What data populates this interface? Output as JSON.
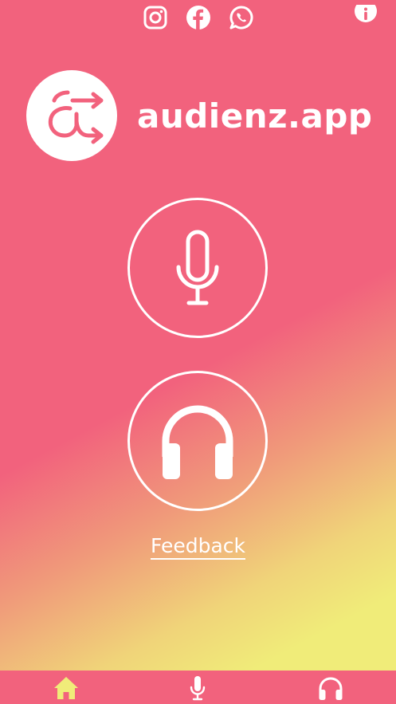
{
  "app": {
    "title": "audienz.app"
  },
  "social": [
    {
      "name": "instagram-icon"
    },
    {
      "name": "facebook-icon"
    },
    {
      "name": "whatsapp-icon"
    }
  ],
  "actions": {
    "speak": {
      "icon": "microphone-icon"
    },
    "listen": {
      "icon": "headphones-icon"
    }
  },
  "feedback": {
    "label": "Feedback"
  },
  "tabs": [
    {
      "icon": "home-icon",
      "active": true
    },
    {
      "icon": "microphone-icon",
      "active": false
    },
    {
      "icon": "headphones-icon",
      "active": false
    }
  ],
  "colors": {
    "primary": "#f2627d",
    "accent_yellow": "#f0ec79",
    "active_tab": "#f0ec79",
    "foreground": "#ffffff"
  }
}
